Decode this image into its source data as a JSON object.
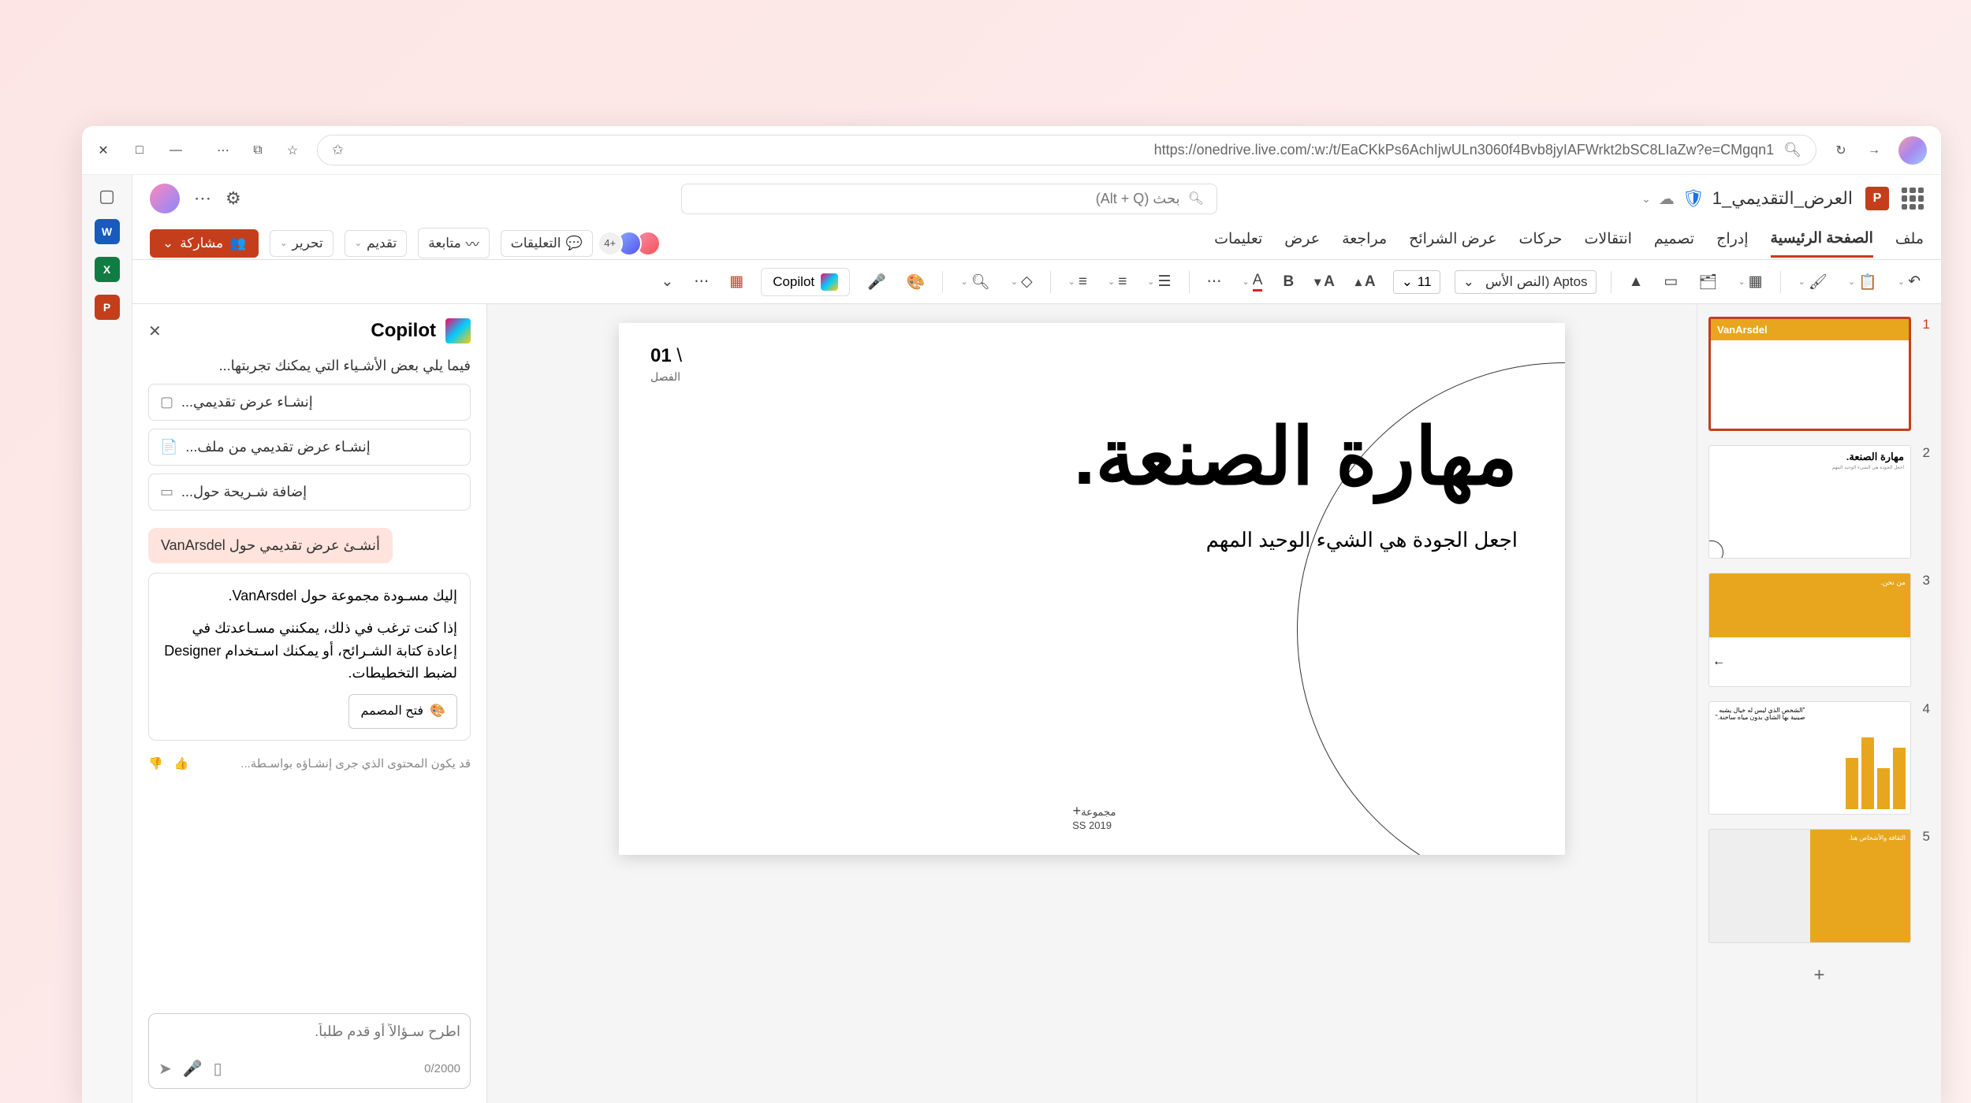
{
  "browser": {
    "url": "https://onedrive.live.com/:w:/t/EaCKkPs6AchIjwULn3060f4Bvb8jyIAFWrkt2bSC8LIaZw?e=CMgqn1"
  },
  "title_bar": {
    "document_name": "العرض_التقديمي_1",
    "search_placeholder": "بحث (Alt + Q)"
  },
  "ribbon": {
    "tabs": [
      "ملف",
      "الصفحة الرئيسية",
      "إدراج",
      "تصميم",
      "انتقالات",
      "حركات",
      "عرض الشرائح",
      "مراجعة",
      "عرض",
      "تعليمات"
    ],
    "active_tab_index": 1,
    "comments_label": "التعليقات",
    "collab_more": "+4",
    "follow_label": "متابعة",
    "present_label": "تقديم",
    "edit_label": "تحرير",
    "share_label": "مشاركة"
  },
  "toolbar": {
    "font_name": "Aptos (النص الأس",
    "font_size": "11",
    "copilot_label": "Copilot"
  },
  "thumbnails": {
    "slides": [
      {
        "num": "1",
        "label": "VanArsdel"
      },
      {
        "num": "2",
        "title": "مهارة الصنعة."
      },
      {
        "num": "3",
        "title": "من نحن."
      },
      {
        "num": "4",
        "quote": "\"الشخص الذي ليس له خيال يشبه صينية بها الشاي بدون مياه ساخنة.\""
      },
      {
        "num": "5",
        "title": "الثقافة والأشخاص هنا."
      }
    ]
  },
  "slide": {
    "section_num": "01",
    "chapter": "الفصل",
    "title": "مهارة الصنعة.",
    "subtitle": "اجعل الجودة هي الشيء الوحيد المهم",
    "footer_line1": "مجموعة",
    "footer_line2": "SS 2019"
  },
  "copilot": {
    "title": "Copilot",
    "intro": "فيما يلي بعض الأشـياء التي يمكنك تجربتها...",
    "suggestions": [
      "إنشـاء عرض تقديمي...",
      "إنشـاء عرض تقديمي من ملف...",
      "إضافة شـريحة حول..."
    ],
    "user_prompt": "أنشـئ عرض تقديمي حول VanArsdel",
    "reply_p1": "إليك مسـودة مجموعة حول VanArsdel.",
    "reply_p2": "إذا كنت ترغب في ذلك، يمكنني مسـاعدتك في إعادة كتابة الشـرائح، أو يمكنك اسـتخدام Designer لضبط التخطيطات.",
    "designer_btn": "فتح المصمم",
    "disclaimer": "قد يكون المحتوى الذي جرى إنشـاؤه بواسـطة...",
    "input_placeholder": "اطرح سـؤالاً أو قدم طلباً.",
    "counter": "0/2000"
  }
}
